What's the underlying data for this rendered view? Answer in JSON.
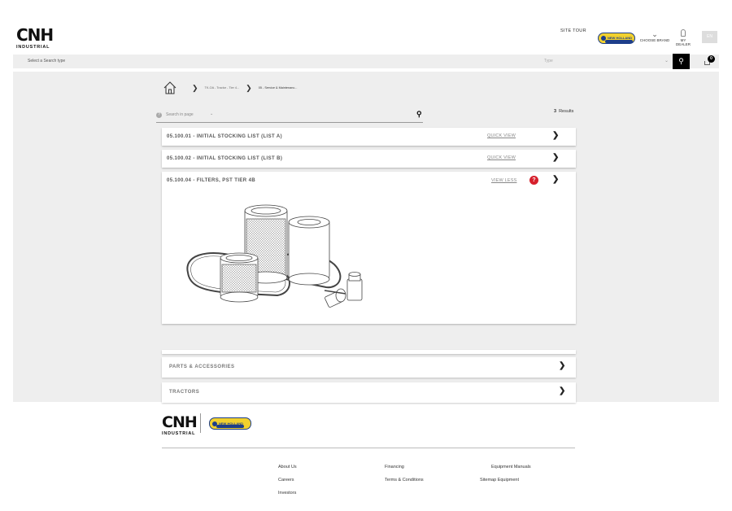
{
  "header": {
    "logo": {
      "main": "CNH",
      "sub": "INDUSTRIAL"
    },
    "site_tour": "SITE TOUR",
    "brand_badge": "NEW HOLLAND",
    "choose_brand": "CHOOSE BRAND",
    "my_dealer": "MY DEALER",
    "language": "EN"
  },
  "search": {
    "placeholder": "Select a Search type",
    "type_label": "Type",
    "cart_count": "0"
  },
  "breadcrumb": {
    "items": [
      "TK-OA - Tractor - Tier 4...",
      "05 - Service & Maintenanc..."
    ]
  },
  "page_search": {
    "placeholder": "Search in page",
    "results_count": "3",
    "results_label": "Results"
  },
  "items": [
    {
      "title": "05.100.01 - INITIAL STOCKING LIST (LIST A)",
      "action": "QUICK VIEW"
    },
    {
      "title": "05.100.02 - INITIAL STOCKING LIST (LIST B)",
      "action": "QUICK VIEW"
    },
    {
      "title": "05.100.04 - FILTERS, PST TIER 4B",
      "action": "VIEW LESS",
      "badge": "?"
    }
  ],
  "categories": [
    "PARTS & ACCESSORIES",
    "TRACTORS"
  ],
  "footer": {
    "links_col1": [
      "About Us",
      "Careers",
      "Investors"
    ],
    "links_col2": [
      "Financing",
      "Terms & Conditions"
    ],
    "links_col3": [
      "Equipment Manuals",
      "Sitemap Equipment"
    ]
  },
  "colors": {
    "accent_red": "#d6202c",
    "brand_yellow": "#f2d12e",
    "brand_blue": "#1d3e8a"
  }
}
